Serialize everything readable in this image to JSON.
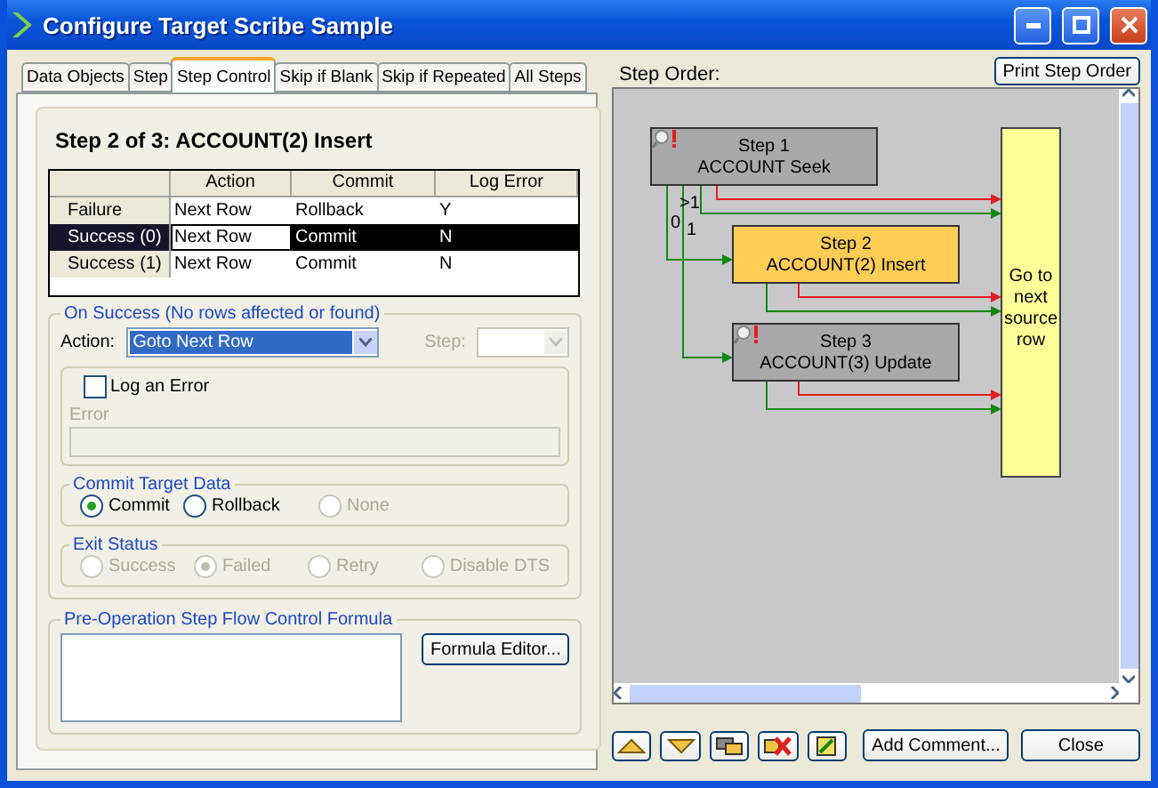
{
  "window": {
    "title": "Configure Target Scribe Sample"
  },
  "tabs": [
    {
      "label": "Data Objects",
      "selected": false
    },
    {
      "label": "Step",
      "selected": false
    },
    {
      "label": "Step Control",
      "selected": true
    },
    {
      "label": "Skip if Blank",
      "selected": false
    },
    {
      "label": "Skip if Repeated",
      "selected": false
    },
    {
      "label": "All Steps",
      "selected": false
    }
  ],
  "step_title": "Step 2 of 3: ACCOUNT(2) Insert",
  "table": {
    "columns": [
      "Action",
      "Commit",
      "Log Error"
    ],
    "rows": [
      {
        "header": "Failure",
        "cells": [
          "Next Row",
          "Rollback",
          "Y"
        ],
        "selected": false
      },
      {
        "header": "Success (0)",
        "cells": [
          "Next Row",
          "Commit",
          "N"
        ],
        "selected": true
      },
      {
        "header": "Success (1)",
        "cells": [
          "Next Row",
          "Commit",
          "N"
        ],
        "selected": false
      }
    ]
  },
  "on_success": {
    "legend": "On Success (No rows affected or found)",
    "action_label": "Action:",
    "action_value": "Goto Next Row",
    "step_label": "Step:",
    "step_disabled": true,
    "log_error": {
      "label": "Log an Error",
      "checked": false
    },
    "error_label": "Error",
    "commit_group": {
      "legend": "Commit Target Data",
      "options": [
        {
          "label": "Commit",
          "selected": true,
          "disabled": false
        },
        {
          "label": "Rollback",
          "selected": false,
          "disabled": false
        },
        {
          "label": "None",
          "selected": false,
          "disabled": true
        }
      ]
    },
    "exit_group": {
      "legend": "Exit Status",
      "options": [
        {
          "label": "Success",
          "selected": false,
          "disabled": true
        },
        {
          "label": "Failed",
          "selected": true,
          "disabled": true
        },
        {
          "label": "Retry",
          "selected": false,
          "disabled": true
        },
        {
          "label": "Disable DTS",
          "selected": false,
          "disabled": true
        }
      ]
    }
  },
  "formula": {
    "legend": "Pre-Operation Step Flow Control Formula",
    "button": "Formula Editor..."
  },
  "step_order": {
    "label": "Step Order:",
    "print_button": "Print Step Order",
    "nodes": [
      {
        "kind": "step",
        "title": "Step 1",
        "subtitle": "ACCOUNT Seek",
        "selected": false,
        "warning": true
      },
      {
        "kind": "step",
        "title": "Step 2",
        "subtitle": "ACCOUNT(2) Insert",
        "selected": true,
        "warning": false
      },
      {
        "kind": "step",
        "title": "Step 3",
        "subtitle": "ACCOUNT(3) Update",
        "selected": false,
        "warning": true
      },
      {
        "kind": "end",
        "label": "Go to next source row"
      }
    ],
    "links": [
      {
        "kind": "failure"
      },
      {
        "kind": "success",
        "label": ">1"
      },
      {
        "kind": "success",
        "label": "0"
      },
      {
        "kind": "success",
        "label": "1"
      },
      {
        "kind": "failure"
      },
      {
        "kind": "success"
      },
      {
        "kind": "failure"
      },
      {
        "kind": "success"
      }
    ]
  },
  "buttons": {
    "add_comment": "Add Comment...",
    "close": "Close"
  }
}
